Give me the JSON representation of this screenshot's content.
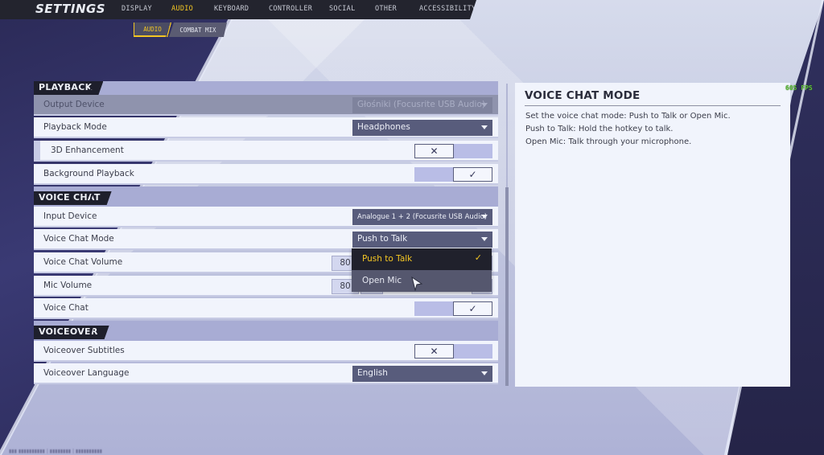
{
  "header": {
    "title": "SETTINGS",
    "tabs": [
      {
        "label": "DISPLAY",
        "active": false
      },
      {
        "label": "AUDIO",
        "active": true
      },
      {
        "label": "KEYBOARD",
        "active": false
      },
      {
        "label": "CONTROLLER",
        "active": false
      },
      {
        "label": "SOCIAL",
        "active": false
      },
      {
        "label": "OTHER",
        "active": false
      },
      {
        "label": "ACCESSIBILITY",
        "active": false
      }
    ],
    "subtabs": [
      {
        "label": "AUDIO",
        "active": true
      },
      {
        "label": "COMBAT MIX",
        "active": false
      }
    ]
  },
  "sections": {
    "playback": {
      "title": "PLAYBACK",
      "output_device": {
        "label": "Output Device",
        "value": "Głośniki (Focusrite USB Audio)",
        "disabled": true
      },
      "playback_mode": {
        "label": "Playback Mode",
        "value": "Headphones"
      },
      "enhancement_3d": {
        "label": "3D Enhancement",
        "enabled": false
      },
      "background_playback": {
        "label": "Background Playback",
        "enabled": true
      }
    },
    "voice_chat": {
      "title": "VOICE CHAT",
      "input_device": {
        "label": "Input Device",
        "value": "Analogue 1 + 2 (Focusrite USB Audio)"
      },
      "voice_chat_mode": {
        "label": "Voice Chat Mode",
        "value": "Push to Talk",
        "options": [
          {
            "label": "Push to Talk",
            "selected": true
          },
          {
            "label": "Open Mic",
            "selected": false
          }
        ]
      },
      "voice_chat_volume": {
        "label": "Voice Chat Volume",
        "value": "80"
      },
      "mic_volume": {
        "label": "Mic Volume",
        "value": "80"
      },
      "voice_chat": {
        "label": "Voice Chat",
        "enabled": true
      }
    },
    "voiceover": {
      "title": "VOICEOVER",
      "subtitles": {
        "label": "Voiceover Subtitles",
        "enabled": false
      },
      "language": {
        "label": "Voiceover Language",
        "value": "English"
      }
    }
  },
  "info_panel": {
    "title": "VOICE CHAT MODE",
    "lines": [
      "Set the voice chat mode: Push to Talk or Open Mic.",
      "Push to Talk: Hold the hotkey to talk.",
      "Open Mic: Talk through your microphone."
    ]
  },
  "overlay": {
    "fps": "605 FPS"
  },
  "icons": {
    "off": "✕",
    "on": "✓",
    "check": "✓"
  },
  "colors": {
    "accent": "#f3c623",
    "nav_bg": "#23242e",
    "select_bg": "#585c7c",
    "fps": "#5fbf3a"
  }
}
